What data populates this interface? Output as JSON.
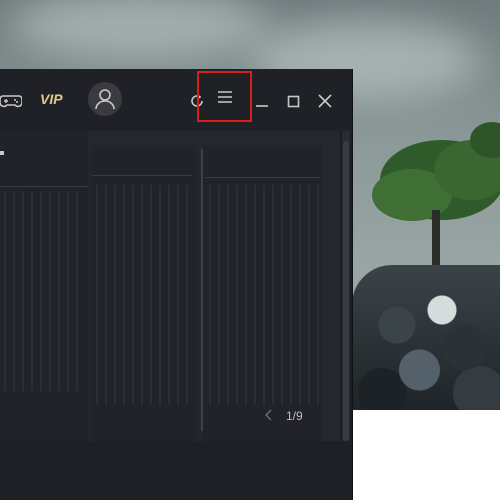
{
  "window": {
    "vip_label": "VIP",
    "pager_text": "1/9"
  },
  "icons": {
    "gamepad": "gamepad-icon",
    "avatar": "user-icon",
    "refresh": "refresh-icon",
    "menu": "menu-icon",
    "minimize": "minimize-icon",
    "maximize": "maximize-icon",
    "close": "close-icon",
    "pager_prev": "chevron-left-icon"
  },
  "colors": {
    "vip": "#e3c98a",
    "highlight_box": "#d81e1e",
    "window_bg": "#1d1e23"
  }
}
